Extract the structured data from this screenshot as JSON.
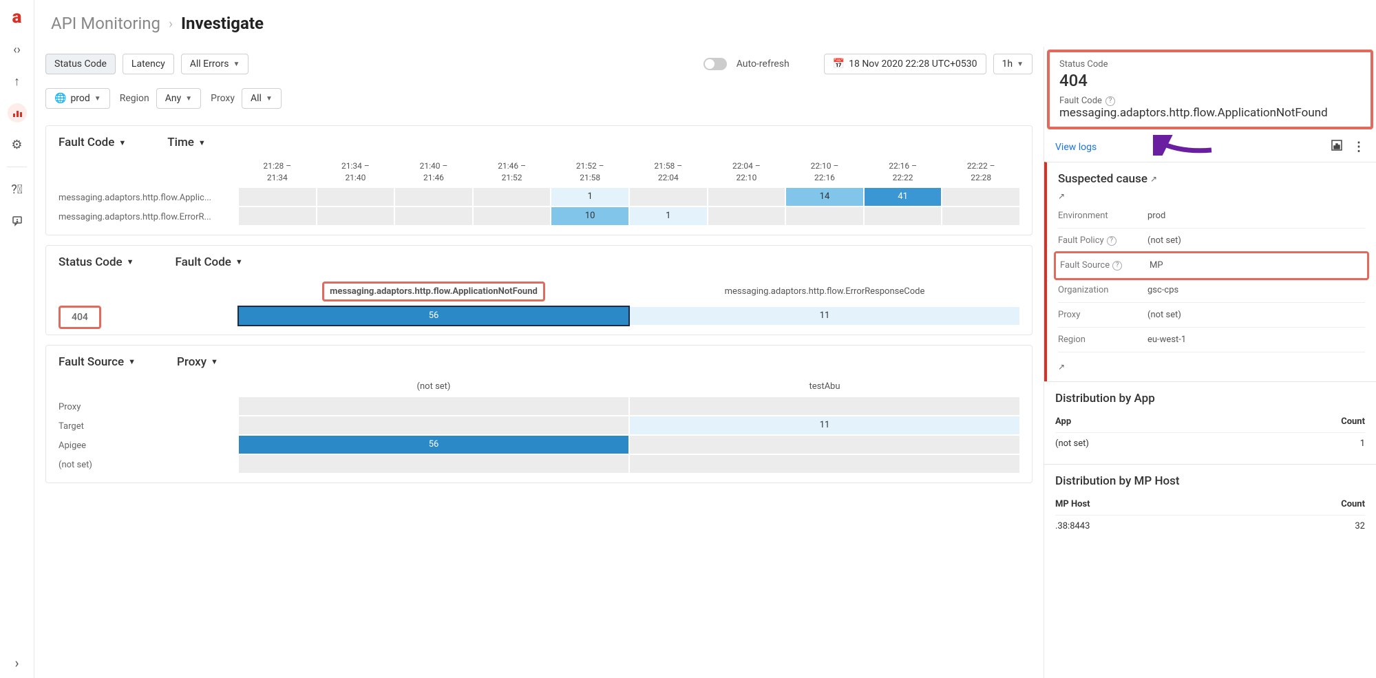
{
  "header": {
    "breadcrumb": "API Monitoring",
    "page": "Investigate"
  },
  "toolbar": {
    "status_code": "Status Code",
    "latency": "Latency",
    "all_errors": "All Errors",
    "auto_refresh": "Auto-refresh",
    "datetime": "18 Nov 2020 22:28 UTC+0530",
    "range": "1h",
    "env": "prod",
    "region_label": "Region",
    "region_any": "Any",
    "proxy_label": "Proxy",
    "proxy_all": "All"
  },
  "panel1": {
    "dim1": "Fault Code",
    "dim2": "Time",
    "columns": [
      "21:28 – 21:34",
      "21:34 – 21:40",
      "21:40 – 21:46",
      "21:46 – 21:52",
      "21:52 – 21:58",
      "21:58 – 22:04",
      "22:04 – 22:10",
      "22:10 – 22:16",
      "22:16 – 22:22",
      "22:22 – 22:28"
    ],
    "rows": [
      {
        "label": "messaging.adaptors.http.flow.Applic...",
        "cells": [
          "",
          "",
          "",
          "",
          "1",
          "",
          "",
          "14",
          "41",
          ""
        ]
      },
      {
        "label": "messaging.adaptors.http.flow.ErrorR...",
        "cells": [
          "",
          "",
          "",
          "",
          "10",
          "1",
          "",
          "",
          "",
          ""
        ]
      }
    ]
  },
  "panel2": {
    "dim1": "Status Code",
    "dim2": "Fault Code",
    "status_val": "404",
    "col1": "messaging.adaptors.http.flow.ApplicationNotFound",
    "col2": "messaging.adaptors.http.flow.ErrorResponseCode",
    "v1": "56",
    "v2": "11"
  },
  "panel3": {
    "dim1": "Fault Source",
    "dim2": "Proxy",
    "col1": "(not set)",
    "col2": "testAbu",
    "rows": [
      {
        "label": "Proxy",
        "a": "",
        "b": ""
      },
      {
        "label": "Target",
        "a": "",
        "b": "11"
      },
      {
        "label": "Apigee",
        "a": "56",
        "b": ""
      },
      {
        "label": "(not set)",
        "a": "",
        "b": ""
      }
    ]
  },
  "detail": {
    "status_label": "Status Code",
    "status_val": "404",
    "fault_label": "Fault Code",
    "fault_val": "messaging.adaptors.http.flow.ApplicationNotFound",
    "view_logs": "View logs",
    "suspected": "Suspected cause",
    "kv": [
      {
        "k": "Environment",
        "v": "prod",
        "help": false
      },
      {
        "k": "Fault Policy",
        "v": "(not set)",
        "help": true
      },
      {
        "k": "Fault Source",
        "v": "MP",
        "help": true,
        "hl": true
      },
      {
        "k": "Organization",
        "v": "gsc-cps",
        "help": false
      },
      {
        "k": "Proxy",
        "v": "(not set)",
        "help": false
      },
      {
        "k": "Region",
        "v": "eu-west-1",
        "help": false
      }
    ],
    "dist_app": {
      "title": "Distribution by App",
      "h1": "App",
      "h2": "Count",
      "rows": [
        {
          "a": "(not set)",
          "b": "1"
        }
      ]
    },
    "dist_mp": {
      "title": "Distribution by MP Host",
      "h1": "MP Host",
      "h2": "Count",
      "rows": [
        {
          "a": ".38:8443",
          "b": "32"
        }
      ]
    }
  }
}
